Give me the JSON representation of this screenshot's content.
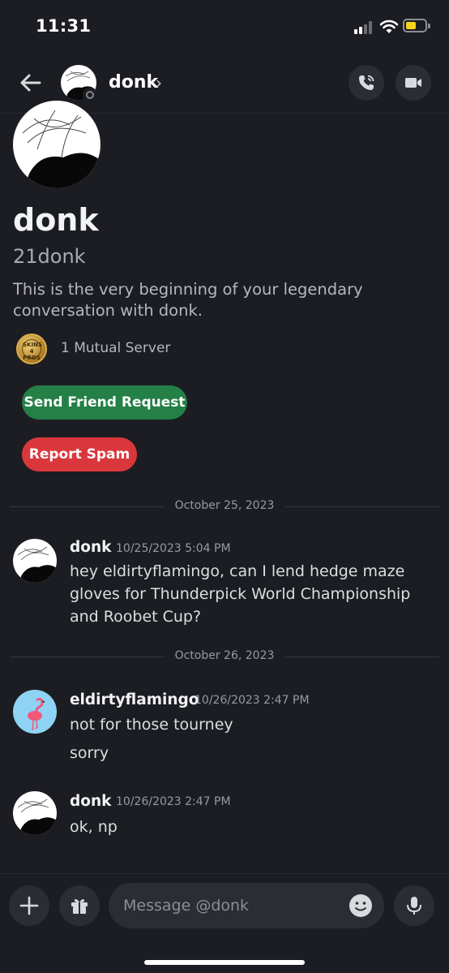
{
  "status_bar": {
    "time": "11:31"
  },
  "header": {
    "name": "donk",
    "chevron": "›"
  },
  "profile": {
    "display_name": "donk",
    "username": "21donk",
    "intro": "This is the very beginning of your legendary conversation with donk.",
    "mutual_server_icon_text": "SKINS 4 PROS",
    "mutual_servers": "1 Mutual Server",
    "send_friend_request": "Send Friend Request",
    "report_spam": "Report Spam"
  },
  "dividers": [
    "October 25, 2023",
    "October 26, 2023"
  ],
  "messages": [
    {
      "author": "donk",
      "timestamp": "10/25/2023 5:04 PM",
      "lines": [
        "hey eldirtyflamingo, can I lend hedge maze gloves for Thunderpick World Championship and Roobet Cup?"
      ]
    },
    {
      "author": "eldirtyflamingo",
      "timestamp": "10/26/2023 2:47 PM",
      "lines": [
        "not for those tourney",
        "sorry"
      ]
    },
    {
      "author": "donk",
      "timestamp": "10/26/2023 2:47 PM",
      "lines": [
        "ok, np"
      ]
    }
  ],
  "composer": {
    "placeholder": "Message @donk"
  },
  "colors": {
    "background": "#1c1d22",
    "friend_button": "#248046",
    "spam_button": "#da373c",
    "accent_avatar": "#8fd3f4"
  },
  "icons": [
    "back-arrow-icon",
    "phone-call-icon",
    "video-camera-icon",
    "plus-icon",
    "gift-icon",
    "emoji-icon",
    "microphone-icon",
    "wifi-icon",
    "battery-icon",
    "signal-icon"
  ]
}
